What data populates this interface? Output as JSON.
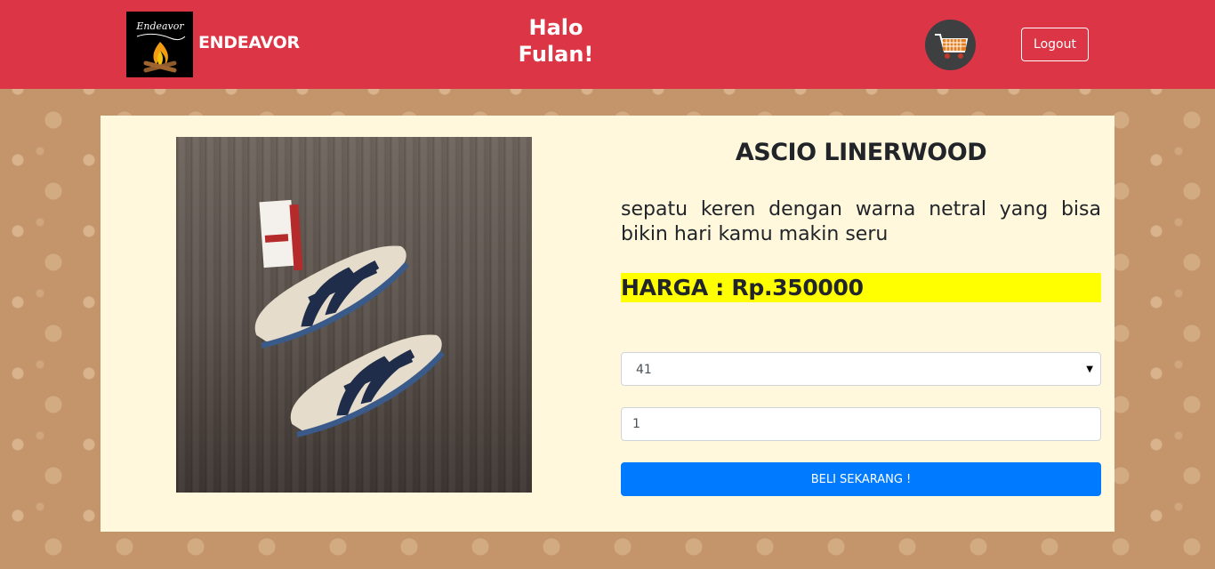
{
  "navbar": {
    "brand_script": "Endeavor",
    "brand_name": "ENDEAVOR",
    "greeting": "Halo Fulan!",
    "cart_icon": "shopping-cart-icon",
    "logout_label": "Logout",
    "color": "#dc3545"
  },
  "product": {
    "image_alt": "shoes-photo",
    "title": "ASCIO LINERWOOD",
    "description": "sepatu keren dengan warna netral yang bisa bikin hari kamu makin seru",
    "price_label": "HARGA : Rp.350000",
    "price_highlight_color": "#ffff00"
  },
  "form": {
    "size_selected": "41",
    "quantity_value": "1",
    "buy_label": "BELI SEKARANG !",
    "buy_color": "#007bff"
  }
}
